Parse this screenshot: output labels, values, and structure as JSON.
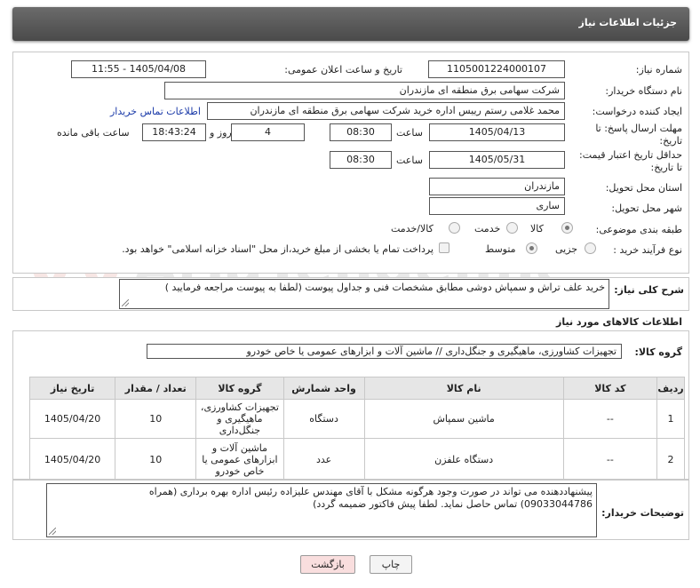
{
  "header": {
    "title": "جزئیات اطلاعات نیاز"
  },
  "form": {
    "need_number_label": "شماره نیاز:",
    "need_number": "1105001224000107",
    "announce_label": "تاریخ و ساعت اعلان عمومی:",
    "announce_value": "1405/04/08 - 11:55",
    "buyer_label": "نام دستگاه خریدار:",
    "buyer_value": "شرکت سهامی برق منطقه ای مازندران",
    "creator_label": "ایجاد کننده درخواست:",
    "creator_value": "محمد غلامی رستم رییس اداره خرید شرکت سهامی برق منطقه ای مازندران",
    "contact_link": "اطلاعات تماس خریدار",
    "reply_label_1": "مهلت ارسال پاسخ: تا",
    "reply_label_2": "تاریخ:",
    "reply_date": "1405/04/13",
    "time_label": "ساعت",
    "reply_time": "08:30",
    "days_value": "4",
    "days_label": "روز و",
    "remaining_time": "18:43:24",
    "remaining_label": "ساعت باقی مانده",
    "validity_label_1": "حداقل تاریخ اعتبار قیمت:",
    "validity_label_2": "تا تاریخ:",
    "validity_date": "1405/05/31",
    "validity_time": "08:30",
    "province_label": "استان محل تحویل:",
    "province_value": "مازندران",
    "city_label": "شهر محل تحویل:",
    "city_value": "ساری",
    "category_label": "طبقه بندی موضوعی:",
    "category_options": [
      "کالا",
      "خدمت",
      "کالا/خدمت"
    ],
    "process_label": "نوع فرآیند خرید :",
    "process_options": [
      "جزیی",
      "متوسط"
    ],
    "payment_text": "پرداخت تمام یا بخشی از مبلغ خرید،از محل \"اسناد خزانه اسلامی\" خواهد بود."
  },
  "description": {
    "label": "شرح کلی نیاز:",
    "value": "خرید علف تراش و سمپاش دوشی مطابق مشخصات فنی و جداول پیوست (لطفا به پیوست مراجعه فرمایید )"
  },
  "goods": {
    "section_title": "اطلاعات کالاهای مورد نیاز",
    "group_label": "گروه کالا:",
    "group_value": "تجهیزات کشاورزی، ماهیگیری و جنگل‌داری //  ماشین آلات و ابزارهای عمومی یا خاص خودرو"
  },
  "table": {
    "headers": [
      "ردیف",
      "کد کالا",
      "نام کالا",
      "واحد شمارش",
      "گروه کالا",
      "تعداد / مقدار",
      "تاریخ نیاز"
    ],
    "rows": [
      {
        "row": "1",
        "code": "--",
        "name": "ماشین سمپاش",
        "unit": "دستگاه",
        "group": "تجهیزات کشاورزی، ماهیگیری و جنگل‌داری",
        "qty": "10",
        "date": "1405/04/20"
      },
      {
        "row": "2",
        "code": "--",
        "name": "دستگاه علفزن",
        "unit": "عدد",
        "group": "ماشین آلات و ابزارهای عمومی یا خاص خودرو",
        "qty": "10",
        "date": "1405/04/20"
      }
    ]
  },
  "buyer_notes": {
    "label": "توضیحات خریدار:",
    "line1": "پیشنهاددهنده می تواند در صورت وجود هرگونه مشکل با آقای مهندس علیزاده رئیس اداره بهره برداری (همراه",
    "line2": "09033044786) تماس حاصل نماید. لطفا پیش فاکتور ضمیمه گردد)"
  },
  "buttons": {
    "print": "چاپ",
    "back": "بازگشت"
  },
  "watermark": "AriaTender.net"
}
